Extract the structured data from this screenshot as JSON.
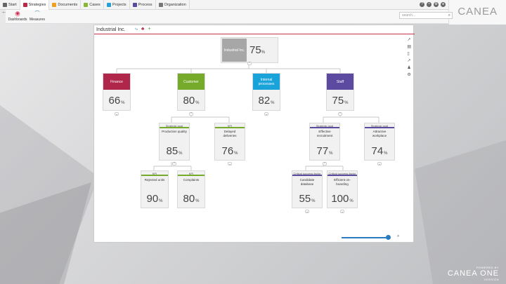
{
  "nav": {
    "tabs": [
      {
        "label": "Start",
        "color": "#666666"
      },
      {
        "label": "Strategies",
        "color": "#c0284a"
      },
      {
        "label": "Documents",
        "color": "#f0a020"
      },
      {
        "label": "Cases",
        "color": "#8ab832"
      },
      {
        "label": "Projects",
        "color": "#2a9fd6"
      },
      {
        "label": "Process",
        "color": "#5b4aa0"
      },
      {
        "label": "Organization",
        "color": "#777777"
      }
    ]
  },
  "brand": "CANEA",
  "toolbar": {
    "dashboards_label": "Dashboards",
    "measures_label": "Measures",
    "search_placeholder": "search..."
  },
  "panel": {
    "title": "Industrial Inc."
  },
  "root": {
    "title": "Industrial Inc.",
    "value": "75",
    "unit": "%"
  },
  "perspectives": [
    {
      "title": "Finance",
      "value": "66",
      "unit": "%",
      "color": "#b0254a"
    },
    {
      "title": "Customer",
      "value": "80",
      "unit": "%",
      "color": "#76aa2a"
    },
    {
      "title": "Internal processes",
      "value": "82",
      "unit": "%",
      "color": "#1aa3d8"
    },
    {
      "title": "Staff",
      "value": "75",
      "unit": "%",
      "color": "#5b4aa0"
    }
  ],
  "level2": [
    {
      "tag": "Strategic goal",
      "label": "Production quality",
      "value": "85",
      "unit": "%",
      "color": "#76aa2a"
    },
    {
      "tag": "KPI",
      "label": "Delayed deliveries",
      "value": "76",
      "unit": "%",
      "color": "#76aa2a"
    },
    {
      "tag": "Strategic goal",
      "label": "Effective recruitment",
      "value": "77",
      "unit": "%",
      "color": "#5b4aa0"
    },
    {
      "tag": "Strategic goal",
      "label": "Attractive workplace",
      "value": "74",
      "unit": "%",
      "color": "#5b4aa0"
    }
  ],
  "level3": [
    {
      "tag": "KPI",
      "label": "Rejected units",
      "value": "90",
      "unit": "%",
      "color": "#76aa2a"
    },
    {
      "tag": "KPI",
      "label": "Complaints",
      "value": "80",
      "unit": "%",
      "color": "#76aa2a"
    },
    {
      "tag": "Critical success factor",
      "label": "Candidate database",
      "value": "55",
      "unit": "%",
      "color": "#5b4aa0"
    },
    {
      "tag": "Critical success factor",
      "label": "Efficient on-boarding",
      "value": "100",
      "unit": "%",
      "color": "#5b4aa0"
    }
  ],
  "footer": {
    "line1": "POWERED BY",
    "line2": "CANEA ONE",
    "line3": "VERSION"
  }
}
